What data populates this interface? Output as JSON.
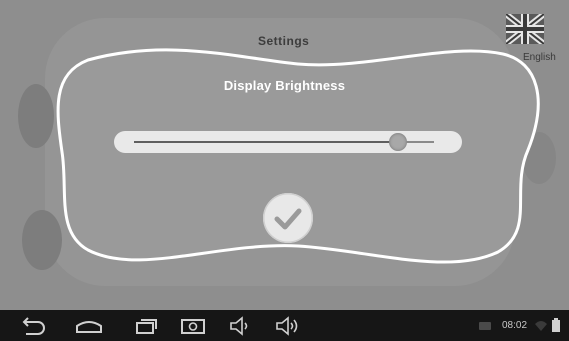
{
  "background": {
    "title": "Settings",
    "language": "English"
  },
  "dialog": {
    "title": "Display Brightness",
    "brightness_level": 0.88,
    "confirm_icon": "checkmark-icon"
  },
  "status_bar": {
    "time": "08:02"
  },
  "nav_icons": [
    "back-icon",
    "home-icon",
    "recent-apps-icon",
    "screenshot-icon",
    "volume-down-icon",
    "volume-up-icon"
  ],
  "colors": {
    "dialog_bg": "#9a9a9a",
    "dialog_border": "#ffffff",
    "nav_bg": "#161616"
  }
}
